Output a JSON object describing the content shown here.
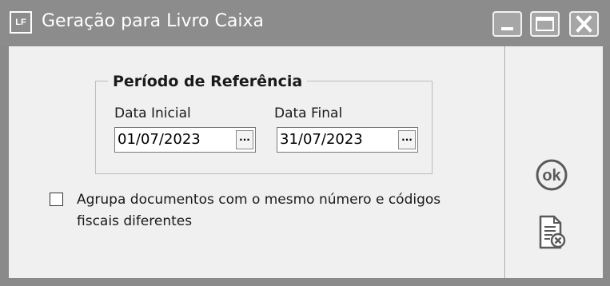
{
  "window": {
    "app_badge": "LF",
    "title": "Geração para Livro Caixa",
    "controls": {
      "minimize": "minimize-icon",
      "maximize": "maximize-icon",
      "close": "close-icon"
    }
  },
  "form": {
    "group_title": "Período de Referência",
    "start_date": {
      "label": "Data Inicial",
      "value": "01/07/2023",
      "picker_label": "···"
    },
    "end_date": {
      "label": "Data Final",
      "value": "31/07/2023",
      "picker_label": "···"
    },
    "group_docs": {
      "checked": false,
      "label": "Agrupa documentos com o mesmo número e códigos fiscais diferentes"
    }
  },
  "actions": {
    "ok": {
      "label": "ok",
      "icon": "ok-icon"
    },
    "cancel": {
      "icon": "cancel-document-icon"
    }
  },
  "colors": {
    "titlebar": "#8c8c8c",
    "client": "#f0f0f0",
    "title_text": "#ffffff"
  }
}
